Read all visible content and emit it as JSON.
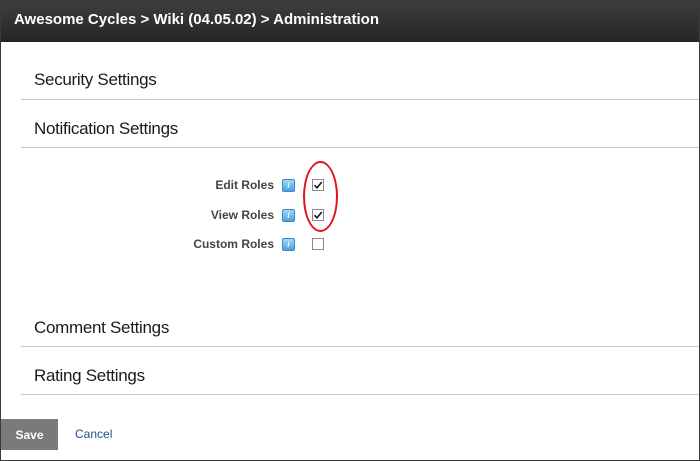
{
  "header": {
    "breadcrumb": "Awesome Cycles > Wiki (04.05.02) > Administration"
  },
  "sections": {
    "security": "Security Settings",
    "notification": "Notification Settings",
    "comment": "Comment Settings",
    "rating": "Rating Settings"
  },
  "roles": [
    {
      "label": "Edit Roles",
      "checked": true,
      "help_icon": "info-icon"
    },
    {
      "label": "View Roles",
      "checked": true,
      "help_icon": "info-icon"
    },
    {
      "label": "Custom Roles",
      "checked": false,
      "help_icon": "info-icon"
    }
  ],
  "actions": {
    "save_label": "Save",
    "cancel_label": "Cancel"
  },
  "colors": {
    "titlebar": "#2e2e2e",
    "highlight": "#e0141e",
    "save_button": "#7a7a7a",
    "link": "#1f4f8f"
  }
}
